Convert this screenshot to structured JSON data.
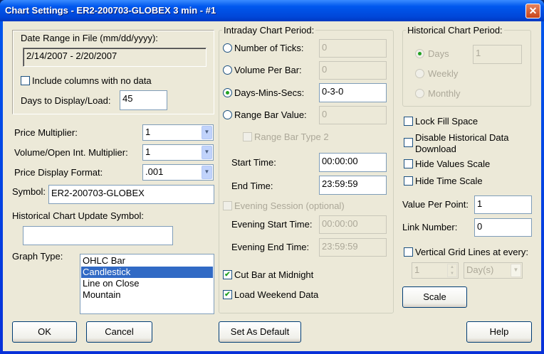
{
  "window": {
    "title": "Chart Settings - ER2-200703-GLOBEX  3 min  - #1",
    "close": "✕"
  },
  "date_range": {
    "label": "Date Range in File (mm/dd/yyyy):",
    "value": "2/14/2007 - 2/20/2007",
    "include_empty_label": "Include columns with no data",
    "include_empty": false,
    "days_label": "Days to Display/Load:",
    "days_value": "45"
  },
  "price_multiplier": {
    "label": "Price Multiplier:",
    "value": "1"
  },
  "volume_multiplier": {
    "label": "Volume/Open Int. Multiplier:",
    "value": "1"
  },
  "price_format": {
    "label": "Price Display Format:",
    "value": ".001"
  },
  "symbol": {
    "label": "Symbol:",
    "value": "ER2-200703-GLOBEX"
  },
  "hist_update": {
    "label": "Historical Chart Update Symbol:",
    "value": ""
  },
  "graph_type": {
    "label": "Graph Type:",
    "items": [
      "OHLC Bar",
      "Candlestick",
      "Line on Close",
      "Mountain"
    ],
    "selected": "Candlestick"
  },
  "intraday": {
    "title": "Intraday Chart Period:",
    "ticks": {
      "label": "Number of Ticks:",
      "value": "0"
    },
    "volume": {
      "label": "Volume Per Bar:",
      "value": "0"
    },
    "dms": {
      "label": "Days-Mins-Secs:",
      "value": "0-3-0"
    },
    "range": {
      "label": "Range Bar Value:",
      "value": "0"
    },
    "range_type2": "Range Bar Type 2",
    "start": {
      "label": "Start Time:",
      "value": "00:00:00"
    },
    "end": {
      "label": "End Time:",
      "value": "23:59:59"
    },
    "evening": "Evening Session (optional)",
    "eve_start": {
      "label": "Evening Start Time:",
      "value": "00:00:00"
    },
    "eve_end": {
      "label": "Evening End Time:",
      "value": "23:59:59"
    },
    "cut_bar": "Cut Bar at Midnight",
    "load_weekend": "Load Weekend Data"
  },
  "historical": {
    "title": "Historical Chart Period:",
    "days": "Days",
    "days_value": "1",
    "weekly": "Weekly",
    "monthly": "Monthly"
  },
  "options": {
    "lock_fill": "Lock Fill Space",
    "disable_hist": "Disable Historical Data Download",
    "hide_values": "Hide Values Scale",
    "hide_time": "Hide Time Scale",
    "value_per_point": {
      "label": "Value Per Point:",
      "value": "1"
    },
    "link_number": {
      "label": "Link Number:",
      "value": "0"
    },
    "vgrid": "Vertical Grid Lines at every:",
    "vgrid_value": "1",
    "vgrid_unit": "Day(s)",
    "scale": "Scale"
  },
  "buttons": {
    "ok": "OK",
    "cancel": "Cancel",
    "default": "Set As Default",
    "help": "Help"
  },
  "check": "✔"
}
